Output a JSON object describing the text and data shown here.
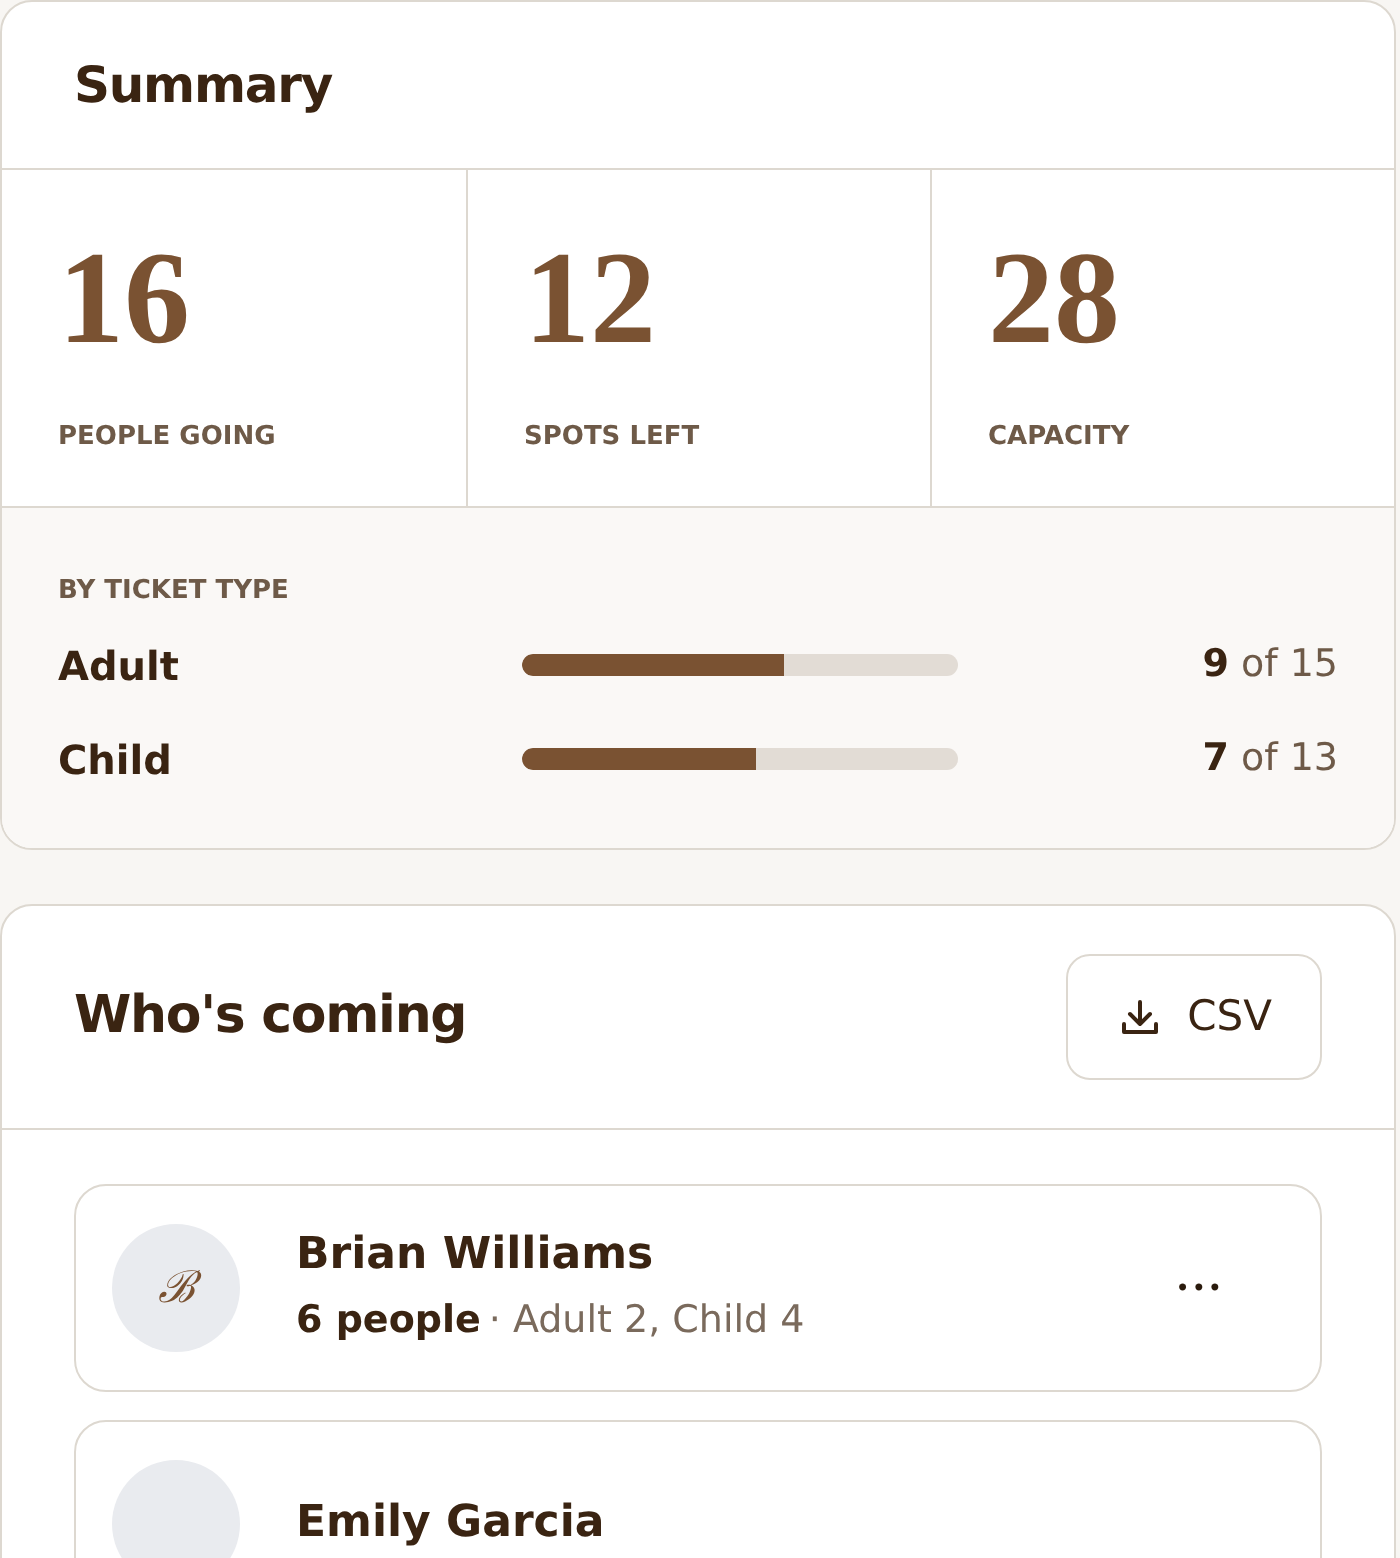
{
  "summary": {
    "title": "Summary",
    "stats": [
      {
        "value": "16",
        "label": "PEOPLE GOING"
      },
      {
        "value": "12",
        "label": "SPOTS LEFT"
      },
      {
        "value": "28",
        "label": "CAPACITY"
      }
    ],
    "ticket_section": {
      "heading": "BY TICKET TYPE",
      "tickets": [
        {
          "name": "Adult",
          "level": 0.6,
          "count": "**9** of 15"
        },
        {
          "name": "Child",
          "level": 0.538,
          "count": "**7** of 13"
        }
      ]
    }
  },
  "guests": {
    "title": "Who's coming",
    "export_button": "CSV",
    "items": [
      {
        "initial": "ℬ",
        "name": "Brian Williams",
        "people": "6 people",
        "detail": "· Adult 2, Child 4",
        "menu": "•••"
      },
      {
        "name": "Emily Garcia"
      }
    ]
  }
}
